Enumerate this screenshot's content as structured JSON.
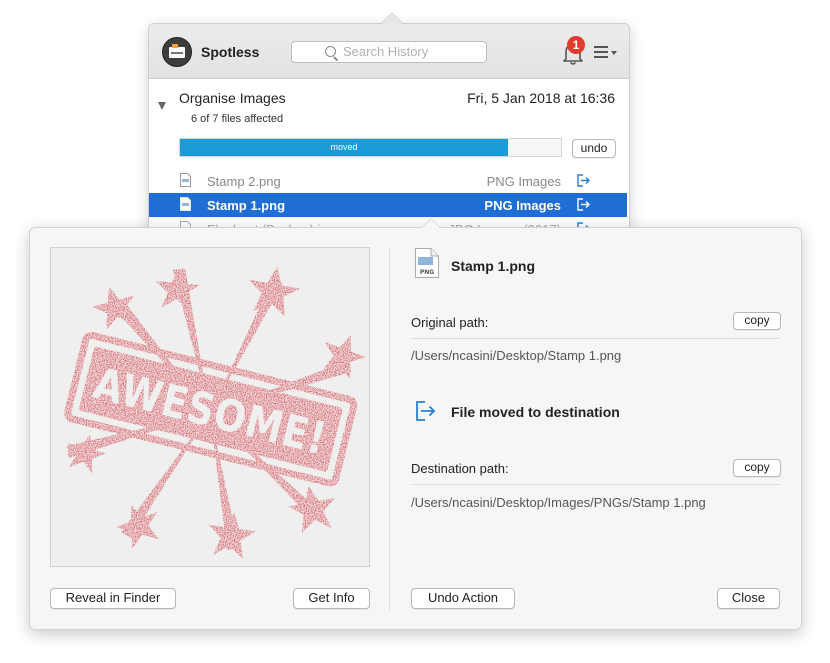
{
  "app": {
    "name": "Spotless",
    "search_placeholder": "Search History",
    "notification_count": "1"
  },
  "task": {
    "title": "Organise Images",
    "date": "Fri, 5 Jan 2018 at 16:36",
    "affected": "6 of 7 files affected",
    "progress_label": "moved",
    "progress_fraction": 0.86,
    "undo_label": "undo"
  },
  "files": [
    {
      "name": "Stamp 2.png",
      "category": "PNG Images",
      "selected": false
    },
    {
      "name": "Stamp 1.png",
      "category": "PNG Images",
      "selected": true
    },
    {
      "name": "Elephant (Backup).jpg",
      "category": "JPG Images (2017)",
      "selected": false
    }
  ],
  "detail": {
    "file_name": "Stamp 1.png",
    "file_type_badge": "PNG",
    "original_label": "Original path:",
    "original_path": "/Users/ncasini/Desktop/Stamp 1.png",
    "copy_label": "copy",
    "action_text": "File moved to destination",
    "destination_label": "Destination path:",
    "destination_path": "/Users/ncasini/Desktop/Images/PNGs/Stamp 1.png",
    "preview_text": "AWESOME!",
    "buttons": {
      "reveal": "Reveal in Finder",
      "info": "Get Info",
      "undo_action": "Undo Action",
      "close": "Close"
    }
  },
  "colors": {
    "accent": "#1e6ed6",
    "progress": "#1a9ad6",
    "badge": "#e23b2e",
    "stamp": "#d6414a",
    "move_icon": "#2a7fcf"
  }
}
